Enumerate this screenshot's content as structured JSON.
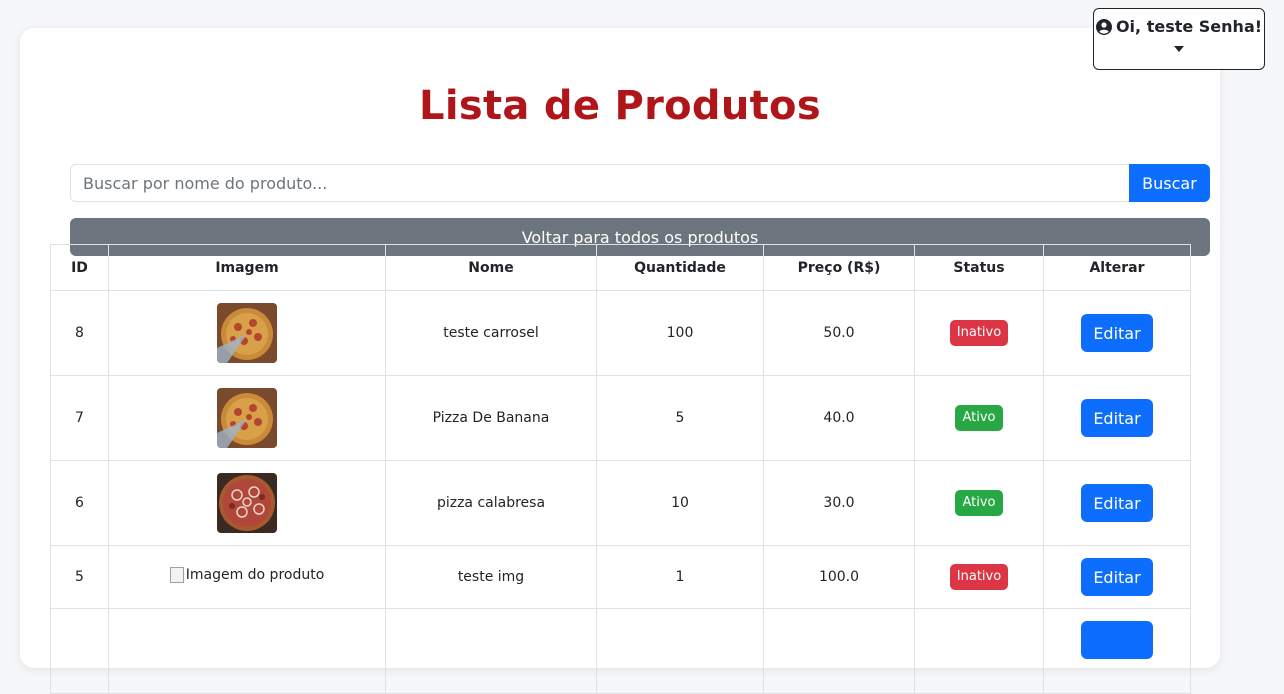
{
  "page": {
    "title": "Lista de Produtos"
  },
  "user_menu": {
    "label": "Oi, teste Senha!"
  },
  "search": {
    "placeholder": "Buscar por nome do produto...",
    "value": "",
    "button_label": "Buscar"
  },
  "back_button": {
    "label": "Voltar para todos os produtos"
  },
  "table": {
    "headers": {
      "id": "ID",
      "image": "Imagem",
      "name": "Nome",
      "quantity": "Quantidade",
      "price": "Preço (R$)",
      "status": "Status",
      "action": "Alterar"
    },
    "rows": [
      {
        "id": "8",
        "image": "pizza-pepperoni-photo",
        "name": "teste carrosel",
        "quantity": "100",
        "price": "50.0",
        "status": "Inativo",
        "action": "Editar"
      },
      {
        "id": "7",
        "image": "pizza-pepperoni-photo",
        "name": "Pizza De Banana",
        "quantity": "5",
        "price": "40.0",
        "status": "Ativo",
        "action": "Editar"
      },
      {
        "id": "6",
        "image": "pizza-calabresa-photo",
        "name": "pizza calabresa",
        "quantity": "10",
        "price": "30.0",
        "status": "Ativo",
        "action": "Editar"
      },
      {
        "id": "5",
        "image_alt": "Imagem do produto",
        "name": "teste img",
        "quantity": "1",
        "price": "100.0",
        "status": "Inativo",
        "action": "Editar"
      }
    ]
  },
  "colors": {
    "title": "#b0151a",
    "primary": "#0d6efd",
    "secondary": "#6c757d",
    "inactive": "#dc3545",
    "active": "#28a745"
  }
}
